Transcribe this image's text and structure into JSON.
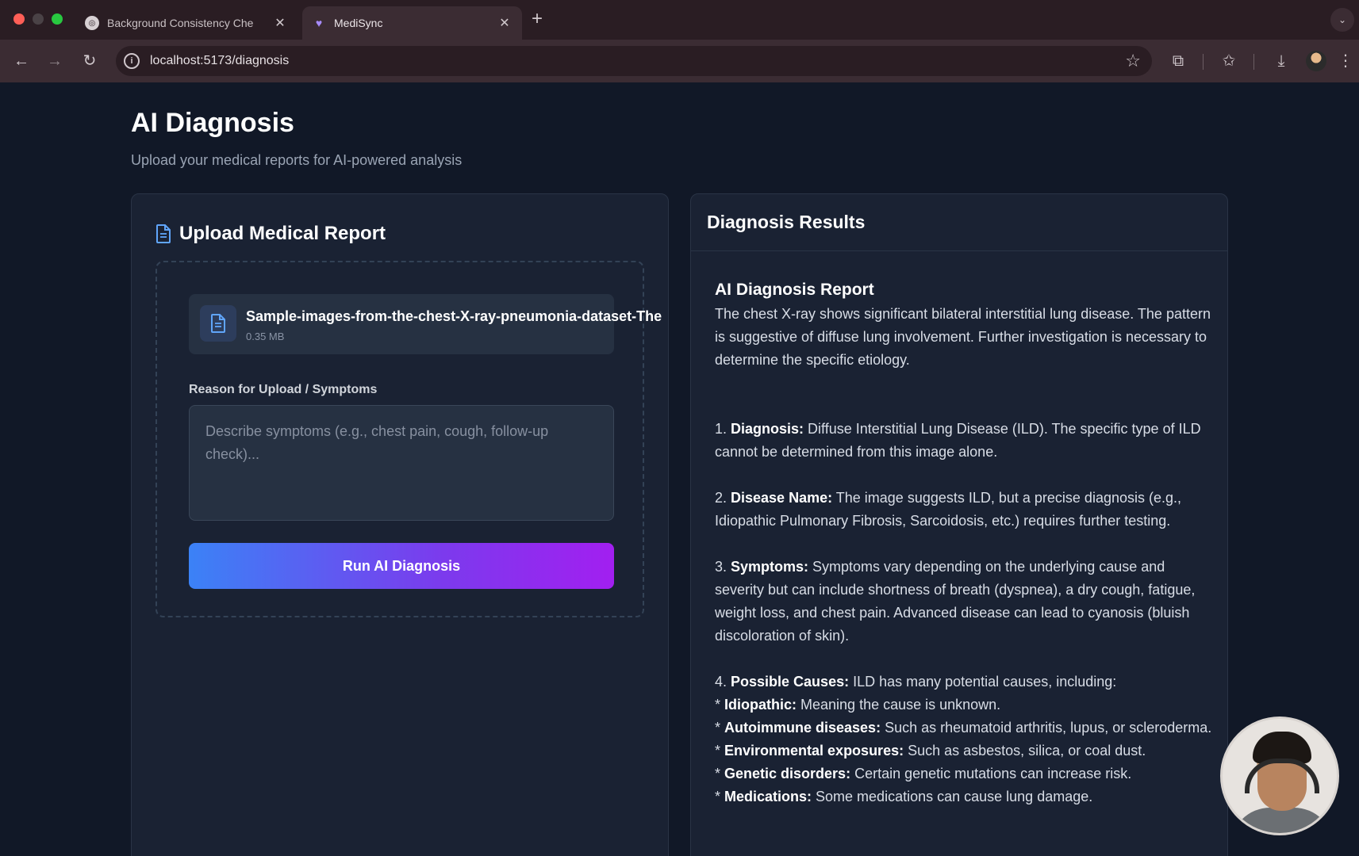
{
  "browser": {
    "tabs": [
      {
        "title": "Background Consistency Che",
        "active": false
      },
      {
        "title": "MediSync",
        "active": true
      }
    ],
    "new_tab_label": "+",
    "url": "localhost:5173/diagnosis"
  },
  "page": {
    "title": "AI Diagnosis",
    "subtitle": "Upload your medical reports for AI-powered analysis"
  },
  "upload": {
    "title": "Upload Medical Report",
    "file": {
      "name": "Sample-images-from-the-chest-X-ray-pneumonia-dataset-The",
      "size": "0.35 MB"
    },
    "reason_label": "Reason for Upload / Symptoms",
    "reason_placeholder": "Describe symptoms (e.g., chest pain, cough, follow-up check)...",
    "reason_value": "",
    "run_button": "Run AI Diagnosis"
  },
  "results": {
    "title": "Diagnosis Results",
    "report_title": "AI Diagnosis Report",
    "intro": "The chest X-ray shows significant bilateral interstitial lung disease. The pattern is suggestive of diffuse lung involvement. Further investigation is necessary to determine the specific etiology.",
    "items": [
      {
        "prefix": "1. ",
        "label": "Diagnosis:",
        "text": " Diffuse Interstitial Lung Disease (ILD). The specific type of ILD cannot be determined from this image alone."
      },
      {
        "prefix": "2. ",
        "label": "Disease Name:",
        "text": " The image suggests ILD, but a precise diagnosis (e.g., Idiopathic Pulmonary Fibrosis, Sarcoidosis, etc.) requires further testing."
      },
      {
        "prefix": "3. ",
        "label": "Symptoms:",
        "text": " Symptoms vary depending on the underlying cause and severity but can include shortness of breath (dyspnea), a dry cough, fatigue, weight loss, and chest pain. Advanced disease can lead to cyanosis (bluish discoloration of skin)."
      },
      {
        "prefix": "4. ",
        "label": "Possible Causes:",
        "text": " ILD has many potential causes, including:"
      }
    ],
    "causes": [
      {
        "prefix": "* ",
        "label": "Idiopathic:",
        "text": " Meaning the cause is unknown."
      },
      {
        "prefix": "* ",
        "label": "Autoimmune diseases:",
        "text": " Such as rheumatoid arthritis, lupus, or scleroderma."
      },
      {
        "prefix": "* ",
        "label": "Environmental exposures:",
        "text": " Such as asbestos, silica, or coal dust."
      },
      {
        "prefix": "* ",
        "label": "Genetic disorders:",
        "text": " Certain genetic mutations can increase risk."
      },
      {
        "prefix": "* ",
        "label": "Medications:",
        "text": " Some medications can cause lung damage."
      }
    ]
  },
  "colors": {
    "background": "#111827",
    "card": "#1a2233",
    "accent_start": "#3b82f6",
    "accent_end": "#a21ff0",
    "icon_blue": "#60a5fa"
  },
  "icons": [
    "back-arrow-icon",
    "forward-arrow-icon",
    "reload-icon",
    "site-info-icon",
    "bookmark-star-icon",
    "extensions-icon",
    "bookmarks-icon",
    "download-icon",
    "profile-avatar",
    "menu-kebab-icon",
    "document-icon"
  ]
}
